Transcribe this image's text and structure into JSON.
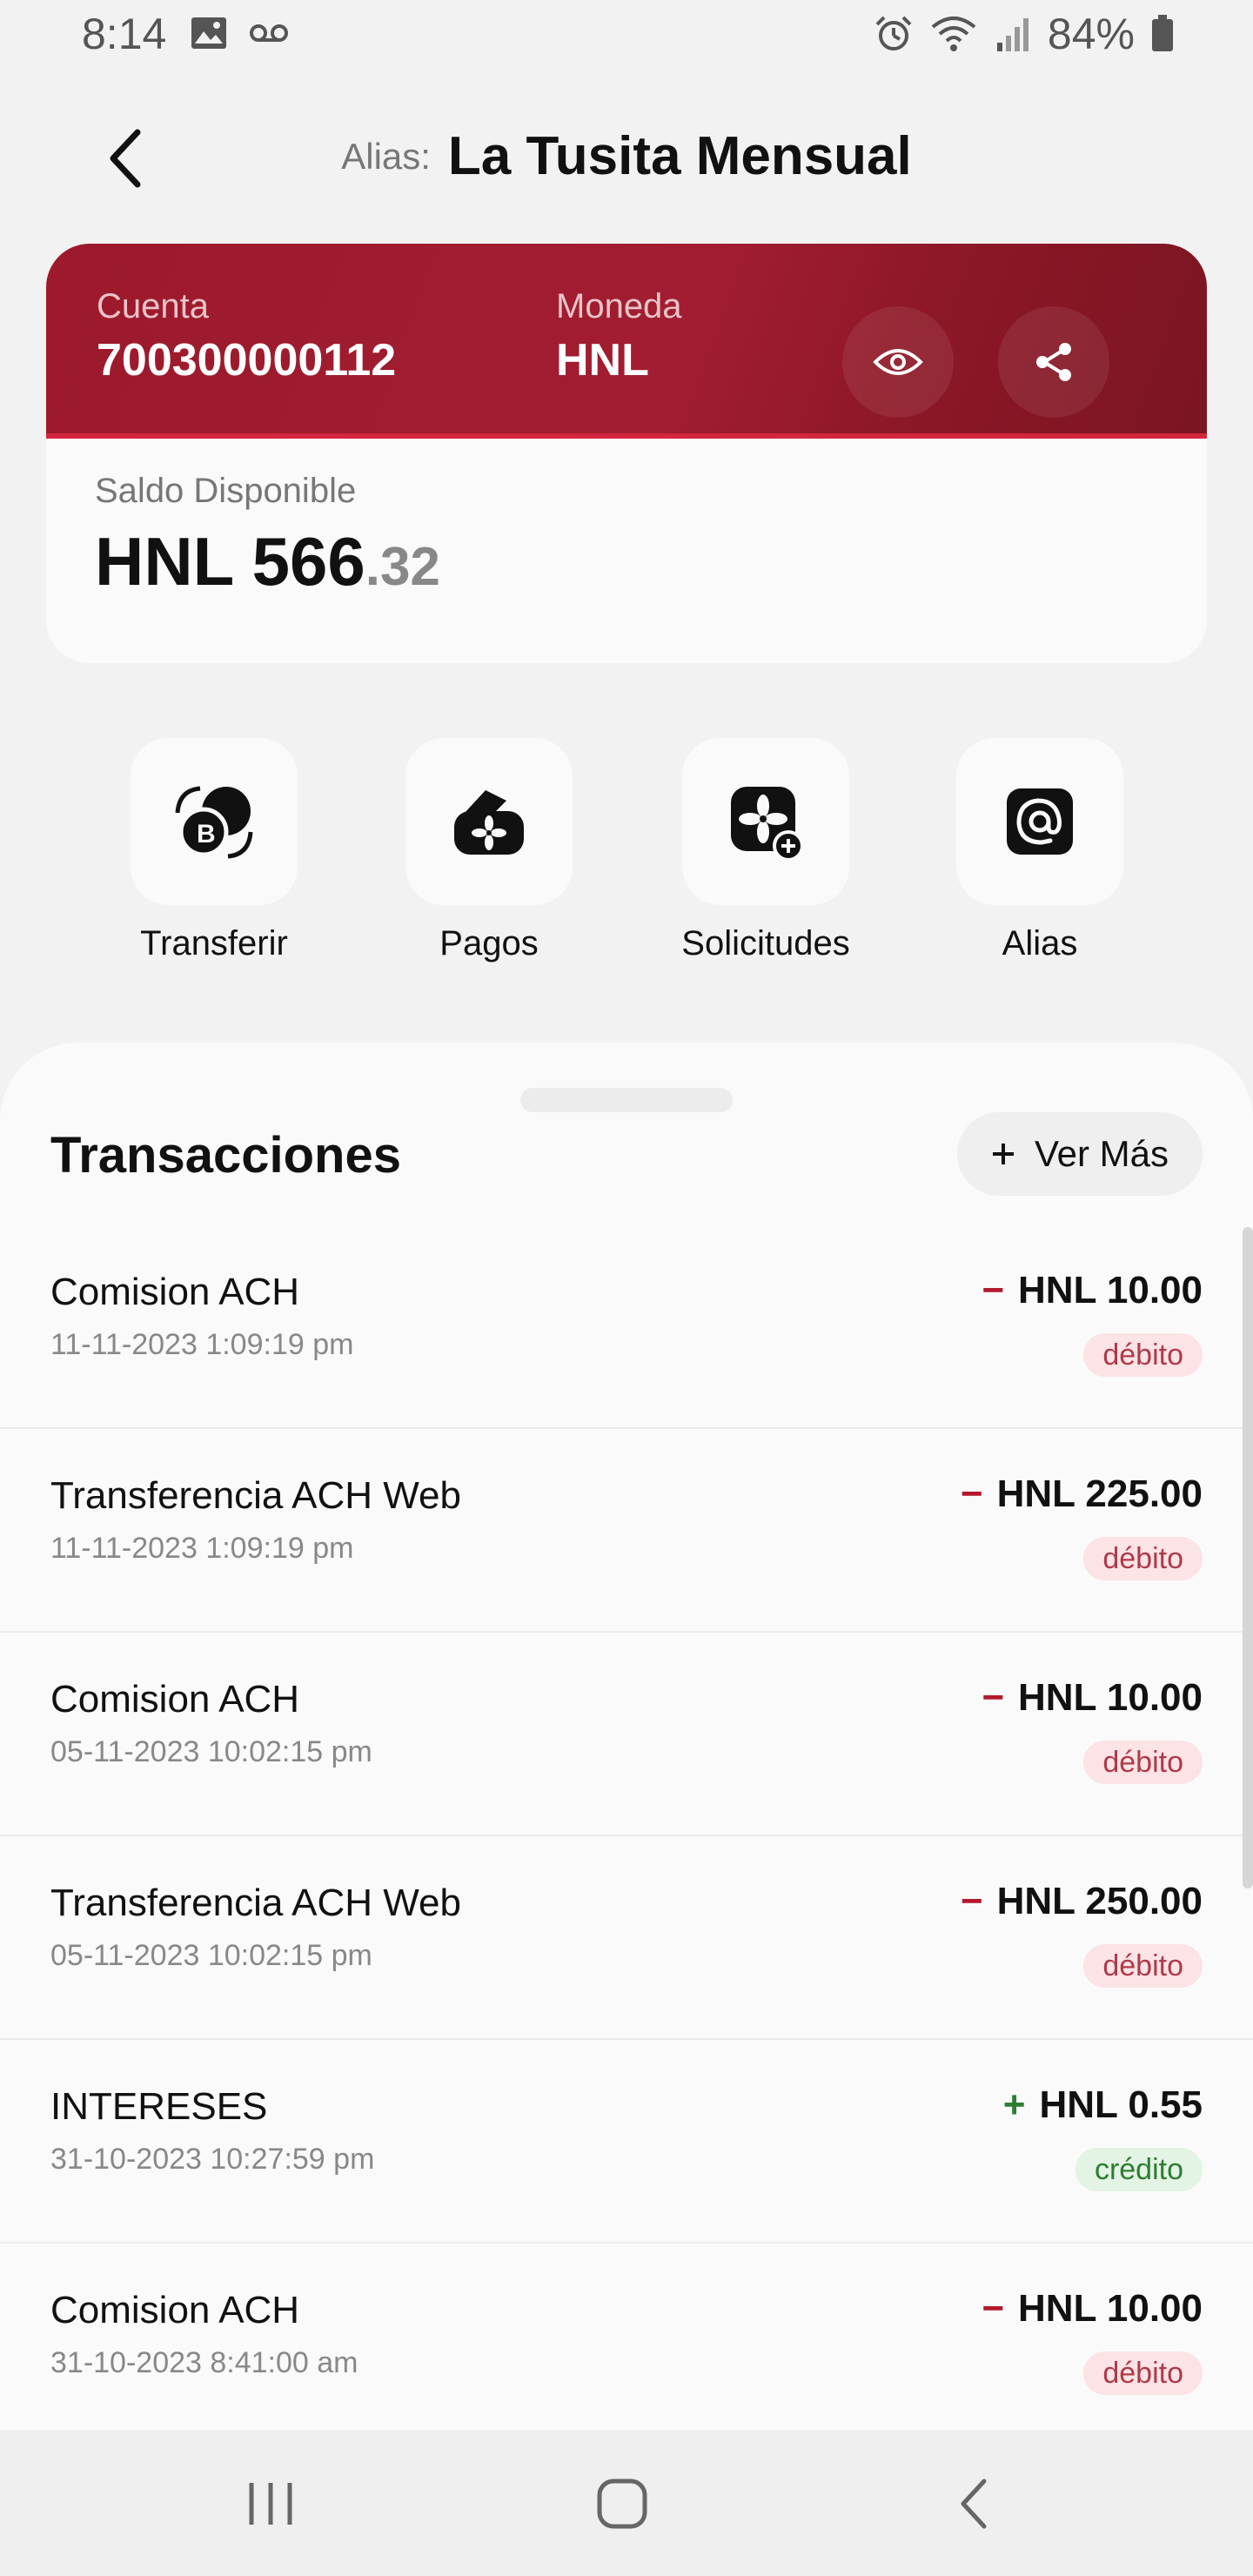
{
  "status_bar": {
    "time": "8:14",
    "battery": "84%",
    "icons": [
      "image-icon",
      "voicemail-icon",
      "alarm-icon",
      "wifi-icon",
      "signal-icon",
      "battery-icon"
    ]
  },
  "header": {
    "alias_prefix": "Alias:",
    "alias_name": "La Tusita Mensual"
  },
  "account": {
    "account_label": "Cuenta",
    "account_number": "700300000112",
    "currency_label": "Moneda",
    "currency": "HNL",
    "balance_label": "Saldo Disponible",
    "balance_main": "HNL 566",
    "balance_cents": ".32"
  },
  "actions": [
    {
      "label": "Transferir",
      "icon": "transfer-icon"
    },
    {
      "label": "Pagos",
      "icon": "payments-icon"
    },
    {
      "label": "Solicitudes",
      "icon": "requests-icon"
    },
    {
      "label": "Alias",
      "icon": "at-sign-icon"
    }
  ],
  "transactions": {
    "title": "Transacciones",
    "more_label": "Ver Más",
    "items": [
      {
        "name": "Comision ACH",
        "date": "11-11-2023 1:09:19 pm",
        "sign": "−",
        "amount": "HNL 10.00",
        "type": "débito"
      },
      {
        "name": "Transferencia ACH Web",
        "date": "11-11-2023 1:09:19 pm",
        "sign": "−",
        "amount": "HNL 225.00",
        "type": "débito"
      },
      {
        "name": "Comision ACH",
        "date": "05-11-2023 10:02:15 pm",
        "sign": "−",
        "amount": "HNL 10.00",
        "type": "débito"
      },
      {
        "name": "Transferencia ACH Web",
        "date": "05-11-2023 10:02:15 pm",
        "sign": "−",
        "amount": "HNL 250.00",
        "type": "débito"
      },
      {
        "name": "INTERESES",
        "date": "31-10-2023 10:27:59 pm",
        "sign": "+",
        "amount": "HNL 0.55",
        "type": "crédito"
      },
      {
        "name": "Comision ACH",
        "date": "31-10-2023 8:41:00 am",
        "sign": "−",
        "amount": "HNL 10.00",
        "type": "débito"
      }
    ]
  },
  "colors": {
    "brand": "#9c1a2c",
    "debit_sign": "#b3192c",
    "debit_badge_bg": "#fbe3e6",
    "debit_badge_text": "#b03a48",
    "credit_sign": "#2e7d32",
    "credit_badge_bg": "#e3f3e4",
    "credit_badge_text": "#2e7d32"
  }
}
